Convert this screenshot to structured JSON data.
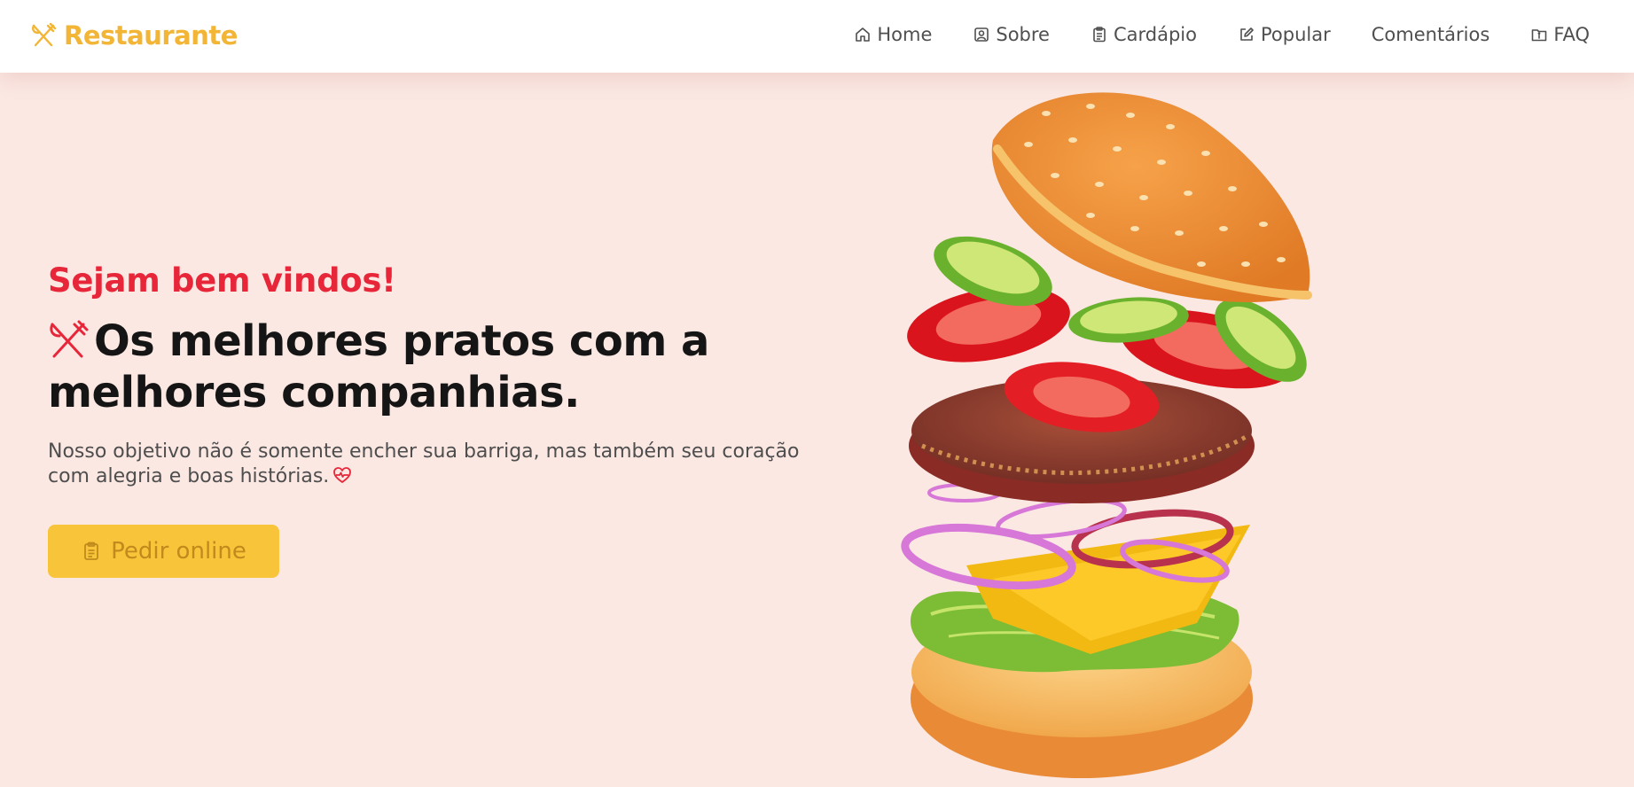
{
  "header": {
    "brand": "Restaurante",
    "nav": [
      {
        "label": "Home",
        "icon": "home-icon"
      },
      {
        "label": "Sobre",
        "icon": "person-badge-icon"
      },
      {
        "label": "Cardápio",
        "icon": "clipboard-icon"
      },
      {
        "label": "Popular",
        "icon": "edit-icon"
      },
      {
        "label": "Comentários",
        "icon": ""
      },
      {
        "label": "FAQ",
        "icon": "folder-info-icon"
      }
    ]
  },
  "hero": {
    "welcome": "Sejam bem vindos!",
    "headline": "Os melhores pratos com a melhores companhias.",
    "description": "Nosso objetivo não é somente encher sua barriga, mas também seu coração com alegria e boas histórias.",
    "order_button": "Pedir online",
    "image": "exploded-burger-illustration"
  },
  "colors": {
    "brand": "#f2b535",
    "accent_red": "#e8263a",
    "hero_background": "#fbe8e3",
    "button": "#f8c43a"
  }
}
